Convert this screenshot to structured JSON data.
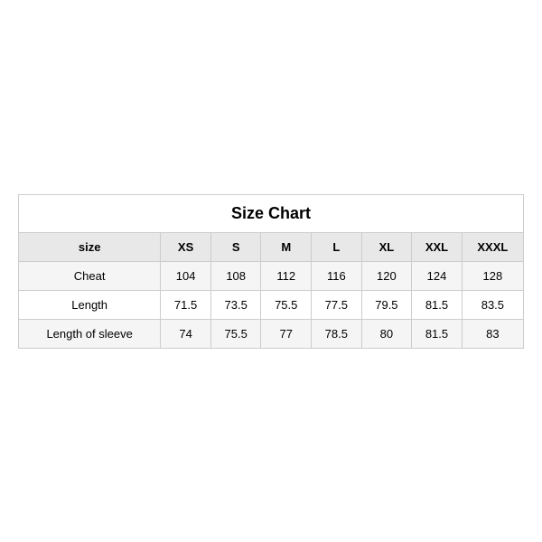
{
  "table": {
    "title": "Size Chart",
    "headers": [
      "size",
      "XS",
      "S",
      "M",
      "L",
      "XL",
      "XXL",
      "XXXL"
    ],
    "rows": [
      {
        "label": "Cheat",
        "values": [
          "104",
          "108",
          "112",
          "116",
          "120",
          "124",
          "128"
        ]
      },
      {
        "label": "Length",
        "values": [
          "71.5",
          "73.5",
          "75.5",
          "77.5",
          "79.5",
          "81.5",
          "83.5"
        ]
      },
      {
        "label": "Length of sleeve",
        "values": [
          "74",
          "75.5",
          "77",
          "78.5",
          "80",
          "81.5",
          "83"
        ]
      }
    ]
  }
}
